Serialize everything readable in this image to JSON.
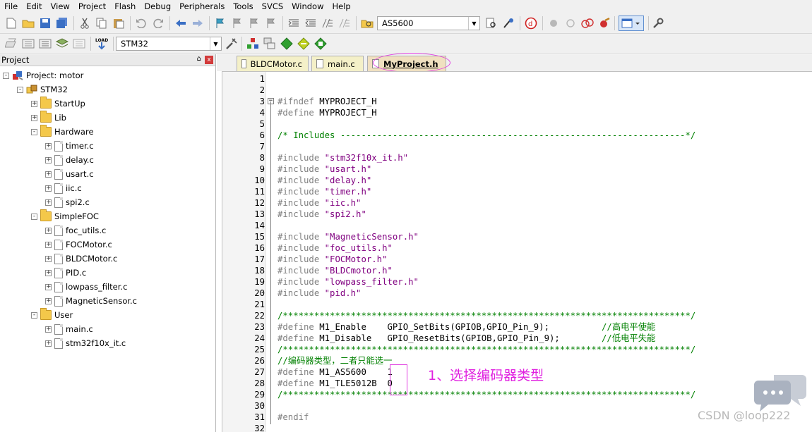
{
  "menubar": [
    "File",
    "Edit",
    "View",
    "Project",
    "Flash",
    "Debug",
    "Peripherals",
    "Tools",
    "SVCS",
    "Window",
    "Help"
  ],
  "toolbar1": {
    "target_combo": "AS5600"
  },
  "toolbar2": {
    "target_combo": "STM32"
  },
  "project_panel": {
    "title": "Project",
    "pin_glyph": "⌂",
    "close_glyph": "x",
    "tree": [
      {
        "label": "Project: motor",
        "kind": "project",
        "expander": "-"
      },
      {
        "label": "STM32",
        "kind": "target",
        "expander": "-"
      },
      {
        "label": "StartUp",
        "kind": "folder",
        "expander": "+"
      },
      {
        "label": "Lib",
        "kind": "folder",
        "expander": "+"
      },
      {
        "label": "Hardware",
        "kind": "folder",
        "expander": "-"
      },
      {
        "label": "timer.c",
        "kind": "file",
        "expander": "+"
      },
      {
        "label": "delay.c",
        "kind": "file",
        "expander": "+"
      },
      {
        "label": "usart.c",
        "kind": "file",
        "expander": "+"
      },
      {
        "label": "iic.c",
        "kind": "file",
        "expander": "+"
      },
      {
        "label": "spi2.c",
        "kind": "file",
        "expander": "+"
      },
      {
        "label": "SimpleFOC",
        "kind": "folder",
        "expander": "-"
      },
      {
        "label": "foc_utils.c",
        "kind": "file",
        "expander": "+"
      },
      {
        "label": "FOCMotor.c",
        "kind": "file",
        "expander": "+"
      },
      {
        "label": "BLDCMotor.c",
        "kind": "file",
        "expander": "+"
      },
      {
        "label": "PID.c",
        "kind": "file",
        "expander": "+"
      },
      {
        "label": "lowpass_filter.c",
        "kind": "file",
        "expander": "+"
      },
      {
        "label": "MagneticSensor.c",
        "kind": "file",
        "expander": "+"
      },
      {
        "label": "User",
        "kind": "folder",
        "expander": "-"
      },
      {
        "label": "main.c",
        "kind": "file",
        "expander": "+"
      },
      {
        "label": "stm32f10x_it.c",
        "kind": "file",
        "expander": "+"
      }
    ]
  },
  "tabs": [
    {
      "label": "BLDCMotor.c",
      "active": false
    },
    {
      "label": "main.c",
      "active": false
    },
    {
      "label": "MyProject.h",
      "active": true
    }
  ],
  "editor": {
    "lines": [
      {
        "n": "1",
        "parts": []
      },
      {
        "n": "2",
        "parts": []
      },
      {
        "n": "3",
        "parts": [
          [
            "kw",
            "#ifndef "
          ],
          [
            "plain",
            "MYPROJECT_H"
          ]
        ]
      },
      {
        "n": "4",
        "parts": [
          [
            "kw",
            "#define "
          ],
          [
            "plain",
            "MYPROJECT_H"
          ]
        ]
      },
      {
        "n": "5",
        "parts": []
      },
      {
        "n": "6",
        "parts": [
          [
            "cmt",
            "/* Includes ------------------------------------------------------------------*/"
          ]
        ]
      },
      {
        "n": "7",
        "parts": []
      },
      {
        "n": "8",
        "parts": [
          [
            "kw",
            "#include "
          ],
          [
            "str",
            "\"stm32f10x_it.h\""
          ]
        ]
      },
      {
        "n": "9",
        "parts": [
          [
            "kw",
            "#include "
          ],
          [
            "str",
            "\"usart.h\""
          ]
        ]
      },
      {
        "n": "10",
        "parts": [
          [
            "kw",
            "#include "
          ],
          [
            "str",
            "\"delay.h\""
          ]
        ]
      },
      {
        "n": "11",
        "parts": [
          [
            "kw",
            "#include "
          ],
          [
            "str",
            "\"timer.h\""
          ]
        ]
      },
      {
        "n": "12",
        "parts": [
          [
            "kw",
            "#include "
          ],
          [
            "str",
            "\"iic.h\""
          ]
        ]
      },
      {
        "n": "13",
        "parts": [
          [
            "kw",
            "#include "
          ],
          [
            "str",
            "\"spi2.h\""
          ]
        ]
      },
      {
        "n": "14",
        "parts": []
      },
      {
        "n": "15",
        "parts": [
          [
            "kw",
            "#include "
          ],
          [
            "str",
            "\"MagneticSensor.h\""
          ]
        ]
      },
      {
        "n": "16",
        "parts": [
          [
            "kw",
            "#include "
          ],
          [
            "str",
            "\"foc_utils.h\""
          ]
        ]
      },
      {
        "n": "17",
        "parts": [
          [
            "kw",
            "#include "
          ],
          [
            "str",
            "\"FOCMotor.h\""
          ]
        ]
      },
      {
        "n": "18",
        "parts": [
          [
            "kw",
            "#include "
          ],
          [
            "str",
            "\"BLDCmotor.h\""
          ]
        ]
      },
      {
        "n": "19",
        "parts": [
          [
            "kw",
            "#include "
          ],
          [
            "str",
            "\"lowpass_filter.h\""
          ]
        ]
      },
      {
        "n": "20",
        "parts": [
          [
            "kw",
            "#include "
          ],
          [
            "str",
            "\"pid.h\""
          ]
        ]
      },
      {
        "n": "21",
        "parts": []
      },
      {
        "n": "22",
        "parts": [
          [
            "cmt",
            "/******************************************************************************/"
          ]
        ]
      },
      {
        "n": "23",
        "parts": [
          [
            "kw",
            "#define "
          ],
          [
            "plain",
            "M1_Enable    GPIO_SetBits(GPIOB,GPIO_Pin_9);          "
          ],
          [
            "cmt",
            "//高电平使能"
          ]
        ]
      },
      {
        "n": "24",
        "parts": [
          [
            "kw",
            "#define "
          ],
          [
            "plain",
            "M1_Disable   GPIO_ResetBits(GPIOB,GPIO_Pin_9);        "
          ],
          [
            "cmt",
            "//低电平失能"
          ]
        ]
      },
      {
        "n": "25",
        "parts": [
          [
            "cmt",
            "/******************************************************************************/"
          ]
        ]
      },
      {
        "n": "26",
        "parts": [
          [
            "cmt",
            "//编码器类型，二者只能选一"
          ]
        ]
      },
      {
        "n": "27",
        "parts": [
          [
            "kw",
            "#define "
          ],
          [
            "plain",
            "M1_AS5600    1"
          ]
        ]
      },
      {
        "n": "28",
        "parts": [
          [
            "kw",
            "#define "
          ],
          [
            "plain",
            "M1_TLE5012B  0"
          ]
        ]
      },
      {
        "n": "29",
        "parts": [
          [
            "cmt",
            "/******************************************************************************/"
          ]
        ]
      },
      {
        "n": "30",
        "parts": []
      },
      {
        "n": "31",
        "parts": [
          [
            "kw",
            "#endif"
          ]
        ]
      },
      {
        "n": "32",
        "parts": []
      }
    ]
  },
  "annotation": "1、选择编码器类型",
  "watermark": "CSDN @loop222",
  "colors": {
    "keyword": "#808080",
    "string": "#800080",
    "comment": "#008000",
    "annotation": "#e020e0"
  }
}
